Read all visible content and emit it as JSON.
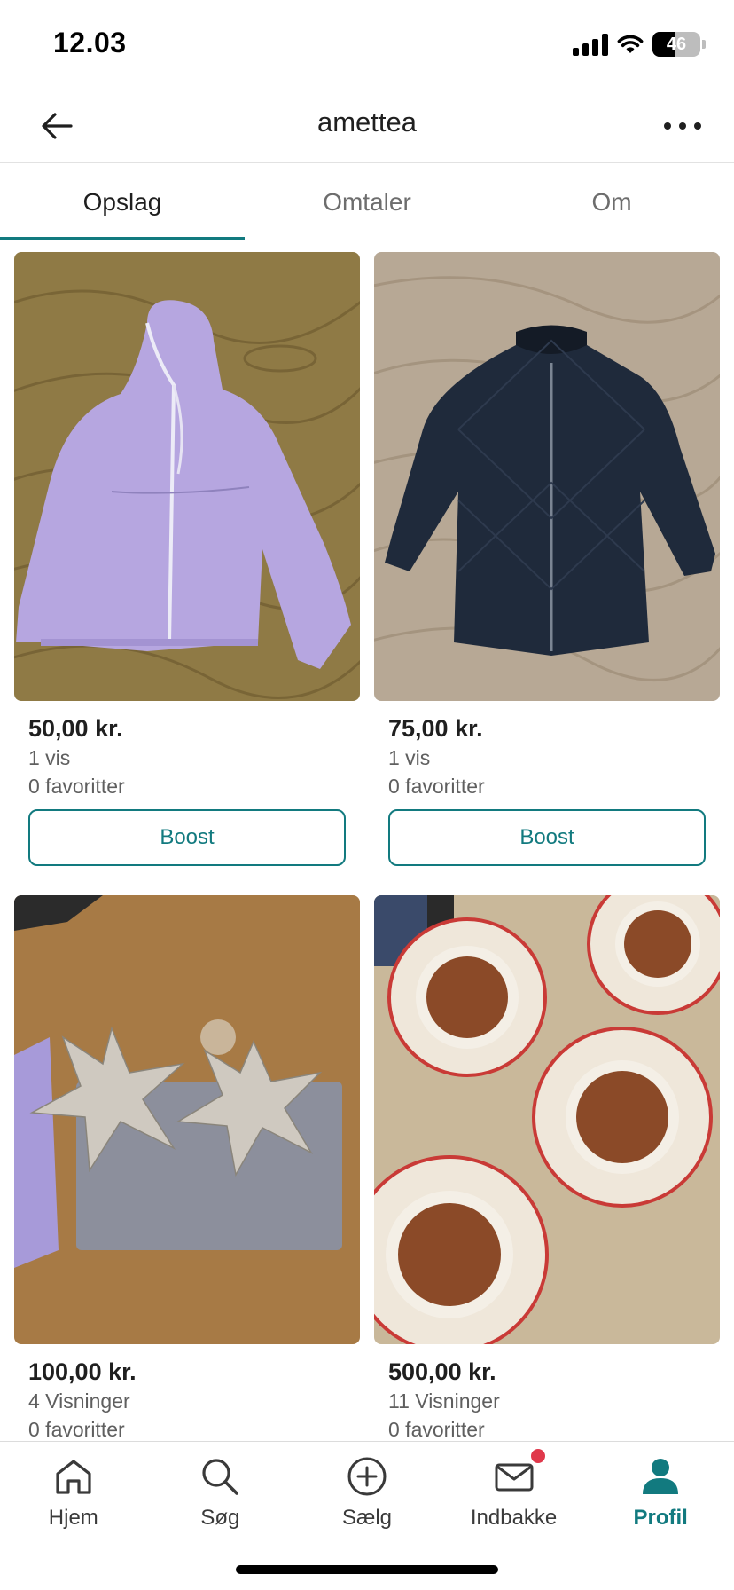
{
  "status_bar": {
    "time": "12.03",
    "battery": "46",
    "battery_level_percent": 46
  },
  "header": {
    "title": "amettea",
    "back_icon": "arrow-left-icon",
    "more_icon": "more-horizontal-icon"
  },
  "tabs": [
    {
      "label": "Opslag",
      "active": true
    },
    {
      "label": "Omtaler",
      "active": false
    },
    {
      "label": "Om",
      "active": false
    }
  ],
  "listings": [
    {
      "price": "50,00 kr.",
      "views": "1 vis",
      "favorites": "0 favoritter",
      "boost_label": "Boost",
      "image": "lavender-hooded-jacket"
    },
    {
      "price": "75,00 kr.",
      "views": "1 vis",
      "favorites": "0 favoritter",
      "boost_label": "Boost",
      "image": "navy-quilted-jacket"
    },
    {
      "price": "100,00 kr.",
      "views": "4 Visninger",
      "favorites": "0 favoritter",
      "image": "paper-christmas-stars"
    },
    {
      "price": "500,00 kr.",
      "views": "11 Visninger",
      "favorites": "0 favoritter",
      "image": "decorative-christmas-plates"
    }
  ],
  "bottom_nav": [
    {
      "label": "Hjem",
      "icon": "home-icon",
      "active": false
    },
    {
      "label": "Søg",
      "icon": "search-icon",
      "active": false
    },
    {
      "label": "Sælg",
      "icon": "plus-circle-icon",
      "active": false
    },
    {
      "label": "Indbakke",
      "icon": "mail-icon",
      "active": false,
      "has_notification": true
    },
    {
      "label": "Profil",
      "icon": "profile-icon",
      "active": true
    }
  ],
  "colors": {
    "accent": "#127a7f",
    "badge": "#e0384b",
    "text": "#1f1f1f",
    "muted": "#5f5f5f"
  }
}
